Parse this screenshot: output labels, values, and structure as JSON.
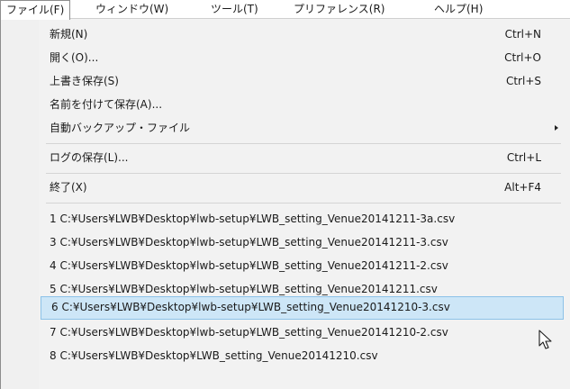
{
  "menubar": {
    "items": [
      {
        "label": "ファイル(F)"
      },
      {
        "label": "ウィンドウ(W)"
      },
      {
        "label": "ツール(T)"
      },
      {
        "label": "プリファレンス(R)"
      },
      {
        "label": "ヘルプ(H)"
      }
    ]
  },
  "file_menu": {
    "new": {
      "label": "新規(N)",
      "shortcut": "Ctrl+N"
    },
    "open": {
      "label": "開く(O)...",
      "shortcut": "Ctrl+O"
    },
    "overwrite_save": {
      "label": "上書き保存(S)",
      "shortcut": "Ctrl+S"
    },
    "save_as": {
      "label": "名前を付けて保存(A)..."
    },
    "auto_backup": {
      "label": "自動バックアップ・ファイル"
    },
    "save_log": {
      "label": "ログの保存(L)...",
      "shortcut": "Ctrl+L"
    },
    "exit": {
      "label": "終了(X)",
      "shortcut": "Alt+F4"
    },
    "recent_files": [
      {
        "label": "1 C:¥Users¥LWB¥Desktop¥lwb-setup¥LWB_setting_Venue20141211-3a.csv"
      },
      {
        "label": "3 C:¥Users¥LWB¥Desktop¥lwb-setup¥LWB_setting_Venue20141211-3.csv"
      },
      {
        "label": "4 C:¥Users¥LWB¥Desktop¥lwb-setup¥LWB_setting_Venue20141211-2.csv"
      },
      {
        "label": "5 C:¥Users¥LWB¥Desktop¥lwb-setup¥LWB_setting_Venue20141211.csv"
      },
      {
        "label": "6 C:¥Users¥LWB¥Desktop¥lwb-setup¥LWB_setting_Venue20141210-3.csv"
      },
      {
        "label": "7 C:¥Users¥LWB¥Desktop¥lwb-setup¥LWB_setting_Venue20141210-2.csv"
      },
      {
        "label": "8 C:¥Users¥LWB¥Desktop¥LWB_setting_Venue20141210.csv"
      }
    ]
  },
  "colors": {
    "highlight_fill": "#cde6f7",
    "highlight_border": "#8cc2e8",
    "menu_background": "#f2f2f2"
  },
  "icons": {
    "submenu_arrow": "chevron-right-icon",
    "cursor": "mouse-pointer-icon"
  }
}
